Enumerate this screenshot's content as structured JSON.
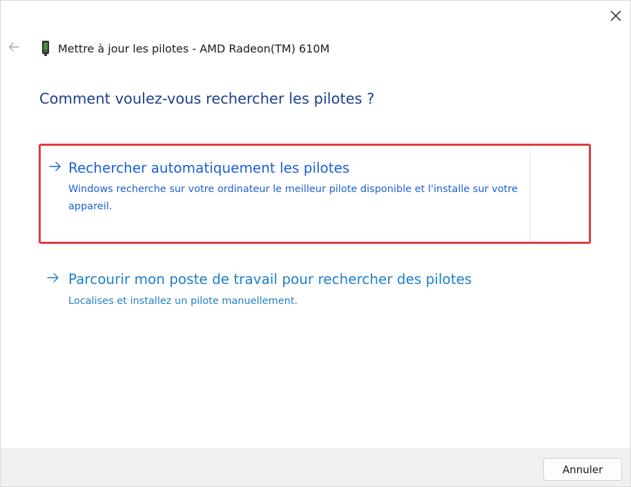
{
  "window": {
    "title": "Mettre à jour les pilotes - AMD Radeon(TM) 610M",
    "icons": {
      "close": "close-icon",
      "back": "back-arrow-icon",
      "device": "display-adapter-icon"
    }
  },
  "main": {
    "question": "Comment voulez-vous rechercher les pilotes ?",
    "options": [
      {
        "title": "Rechercher automatiquement les pilotes",
        "description": "Windows recherche sur votre ordinateur le meilleur pilote disponible et l'installe sur votre appareil.",
        "icon": "arrow-right-icon",
        "highlighted": true
      },
      {
        "title": "Parcourir mon poste de travail pour rechercher des pilotes",
        "description": "Localises et installez un pilote manuellement.",
        "icon": "arrow-right-icon",
        "highlighted": false
      }
    ]
  },
  "footer": {
    "cancel_label": "Annuler"
  },
  "colors": {
    "question_text": "#1c3f8f",
    "option_primary": "#1a5fd6",
    "option_secondary": "#1d7fc9",
    "highlight_border": "#e0393e",
    "footer_bg": "#f0f0f0"
  }
}
